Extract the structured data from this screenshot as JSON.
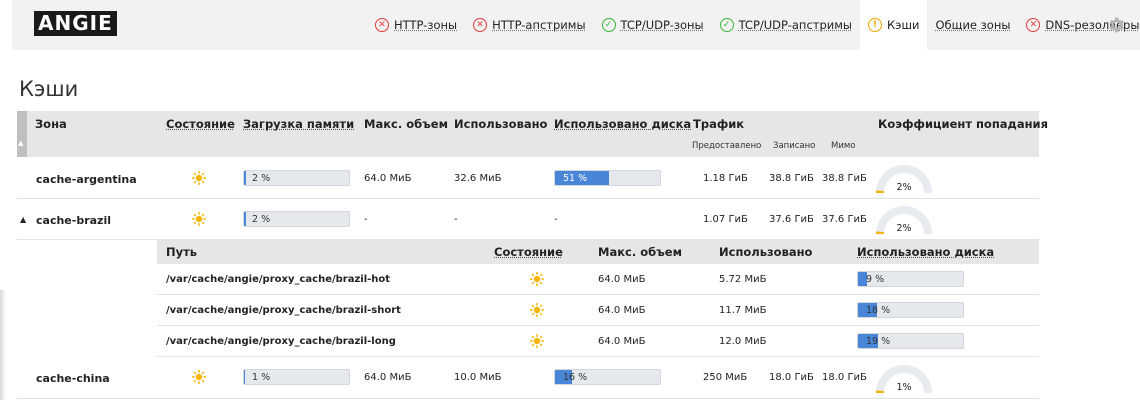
{
  "logo": "ANGIE",
  "nav": {
    "tabs": [
      {
        "label": "HTTP-зоны",
        "status": "error"
      },
      {
        "label": "HTTP-апстримы",
        "status": "error"
      },
      {
        "label": "TCP/UDP-зоны",
        "status": "ok"
      },
      {
        "label": "TCP/UDP-апстримы",
        "status": "ok"
      },
      {
        "label": "Кэши",
        "status": "warning",
        "active": true
      },
      {
        "label": "Общие зоны",
        "status": "none"
      },
      {
        "label": "DNS-резолверы",
        "status": "error"
      }
    ],
    "settings_icon": "gear-icon"
  },
  "page_title": "Кэши",
  "table": {
    "headers": {
      "zone": "Зона",
      "state": "Состояние",
      "mem_load": "Загрузка памяти",
      "max_size": "Макс. объем",
      "used": "Использовано",
      "disk_used": "Использовано диска",
      "traffic": "Трафик",
      "traffic_served": "Предоставлено",
      "traffic_written": "Записано",
      "traffic_bypass": "Мимо",
      "hit_ratio": "Коэффициент попадания"
    },
    "rows": [
      {
        "zone": "cache-argentina",
        "expander": "",
        "state_icon": "sun-icon",
        "mem_load": "2 %",
        "mem_value": 2,
        "max_size": "64.0 МиБ",
        "used": "32.6 МиБ",
        "disk_used": "51 %",
        "disk_value": 51,
        "served": "1.18 ГиБ",
        "written": "38.8 ГиБ",
        "bypass": "38.8 ГиБ",
        "hit": "2%",
        "hit_value": 2
      },
      {
        "zone": "cache-brazil",
        "expander": "▲",
        "state_icon": "sun-icon",
        "mem_load": "2 %",
        "mem_value": 2,
        "max_size": "-",
        "used": "-",
        "disk_used": "-",
        "disk_value": null,
        "served": "1.07 ГиБ",
        "written": "37.6 ГиБ",
        "bypass": "37.6 ГиБ",
        "hit": "2%",
        "hit_value": 2
      },
      {
        "zone": "cache-china",
        "expander": "",
        "state_icon": "sun-icon",
        "mem_load": "1 %",
        "mem_value": 1,
        "max_size": "64.0 МиБ",
        "used": "10.0 МиБ",
        "disk_used": "16 %",
        "disk_value": 16,
        "served": "250 МиБ",
        "written": "18.0 ГиБ",
        "bypass": "18.0 ГиБ",
        "hit": "1%",
        "hit_value": 1
      }
    ]
  },
  "brazil_details": {
    "headers": {
      "path": "Путь",
      "state": "Состояние",
      "max_size": "Макс. объем",
      "used": "Использовано",
      "disk_used": "Использовано диска"
    },
    "rows": [
      {
        "path": "/var/cache/angie/proxy_cache/brazil-hot",
        "state_icon": "sun-icon",
        "max_size": "64.0 МиБ",
        "used": "5.72 МиБ",
        "disk_used": "9 %",
        "disk_value": 9
      },
      {
        "path": "/var/cache/angie/proxy_cache/brazil-short",
        "state_icon": "sun-icon",
        "max_size": "64.0 МиБ",
        "used": "11.7 МиБ",
        "disk_used": "18 %",
        "disk_value": 18
      },
      {
        "path": "/var/cache/angie/proxy_cache/brazil-long",
        "state_icon": "sun-icon",
        "max_size": "64.0 МиБ",
        "used": "12.0 МиБ",
        "disk_used": "19 %",
        "disk_value": 19
      }
    ]
  },
  "colors": {
    "bar_fill": "#4a86d8",
    "bar_track": "#e5e9ee",
    "sun": "#f5b400",
    "gauge_track": "#e8ecf0",
    "gauge_fill": "#f5b400",
    "error": "#e23838",
    "ok": "#38b43a",
    "warning": "#f0a500"
  }
}
